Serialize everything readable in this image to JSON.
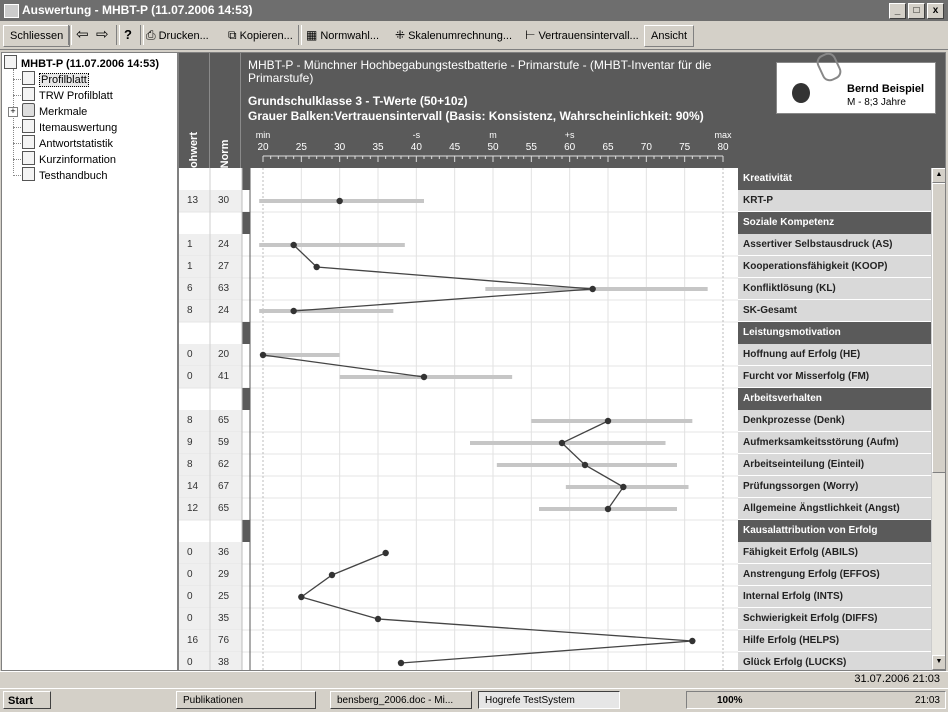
{
  "window": {
    "title": "Auswertung - MHBT-P (11.07.2006 14:53)",
    "min": "_",
    "max": "□",
    "close": "x"
  },
  "toolbar": {
    "close_label": "Schliessen",
    "back_glyph": "⇦",
    "fwd_glyph": "⇨",
    "help_glyph": "?",
    "print_label": "Drucken...",
    "copy_label": "Kopieren...",
    "norm_label": "Normwahl...",
    "scale_label": "Skalenumrechnung...",
    "conf_label": "Vertrauensintervall...",
    "view_label": "Ansicht"
  },
  "tree": {
    "root": "MHBT-P (11.07.2006 14:53)",
    "items": [
      "Profilblatt",
      "TRW Profilblatt",
      "Merkmale",
      "Itemauswertung",
      "Antwortstatistik",
      "Kurzinformation",
      "Testhandbuch"
    ]
  },
  "header": {
    "col_raw": "Rohwert",
    "col_norm": "Norm",
    "title": "MHBT-P - Münchner Hochbegabungstestbatterie - Primarstufe - (MHBT-Inventar für die Primarstufe)",
    "subtitle": "Grundschulklasse 3  -  T-Werte (50+10z)",
    "subtitle2": "Grauer Balken:Vertrauensintervall (Basis: Konsistenz, Wahrscheinlichkeit: 90%)",
    "person_name": "Bernd Beispiel",
    "person_info": "M - 8;3 Jahre"
  },
  "scale": {
    "labels_top": [
      {
        "v": 20,
        "t": "min"
      },
      {
        "v": 40,
        "t": "-s"
      },
      {
        "v": 50,
        "t": "m"
      },
      {
        "v": 60,
        "t": "+s"
      },
      {
        "v": 80,
        "t": "max"
      }
    ],
    "ticks": [
      20,
      25,
      30,
      35,
      40,
      45,
      50,
      55,
      60,
      65,
      70,
      75,
      80
    ]
  },
  "chart_data": {
    "type": "line",
    "xlim": [
      20,
      80
    ],
    "rows": [
      {
        "kind": "cat",
        "label": "Kreativität"
      },
      {
        "kind": "item",
        "label": "KRT-P",
        "raw": "13",
        "norm": "30",
        "ci": [
          19.5,
          41
        ]
      },
      {
        "kind": "cat",
        "label": "Soziale Kompetenz"
      },
      {
        "kind": "item",
        "label": "Assertiver Selbstausdruck (AS)",
        "raw": "1",
        "norm": "24",
        "ci": [
          19.5,
          38.5
        ]
      },
      {
        "kind": "item",
        "label": "Kooperationsfähigkeit (KOOP)",
        "raw": "1",
        "norm": "27",
        "ci": null
      },
      {
        "kind": "item",
        "label": "Konfliktlösung (KL)",
        "raw": "6",
        "norm": "63",
        "ci": [
          49,
          78
        ]
      },
      {
        "kind": "item",
        "label": "SK-Gesamt",
        "raw": "8",
        "norm": "24",
        "ci": [
          19.5,
          37
        ]
      },
      {
        "kind": "cat",
        "label": "Leistungsmotivation"
      },
      {
        "kind": "item",
        "label": "Hoffnung auf Erfolg (HE)",
        "raw": "0",
        "norm": "20",
        "ci": [
          20,
          30
        ]
      },
      {
        "kind": "item",
        "label": "Furcht vor Misserfolg (FM)",
        "raw": "0",
        "norm": "41",
        "ci": [
          30,
          52.5
        ]
      },
      {
        "kind": "cat",
        "label": "Arbeitsverhalten"
      },
      {
        "kind": "item",
        "label": "Denkprozesse (Denk)",
        "raw": "8",
        "norm": "65",
        "ci": [
          55,
          76
        ]
      },
      {
        "kind": "item",
        "label": "Aufmerksamkeitsstörung (Aufm)",
        "raw": "9",
        "norm": "59",
        "ci": [
          47,
          72.5
        ]
      },
      {
        "kind": "item",
        "label": "Arbeitseinteilung (Einteil)",
        "raw": "8",
        "norm": "62",
        "ci": [
          50.5,
          74
        ]
      },
      {
        "kind": "item",
        "label": "Prüfungssorgen (Worry)",
        "raw": "14",
        "norm": "67",
        "ci": [
          59.5,
          75.5
        ]
      },
      {
        "kind": "item",
        "label": "Allgemeine Ängstlichkeit (Angst)",
        "raw": "12",
        "norm": "65",
        "ci": [
          56,
          74
        ]
      },
      {
        "kind": "cat",
        "label": "Kausalattribution von Erfolg"
      },
      {
        "kind": "item",
        "label": "Fähigkeit Erfolg (ABILS)",
        "raw": "0",
        "norm": "36",
        "ci": null
      },
      {
        "kind": "item",
        "label": "Anstrengung Erfolg (EFFOS)",
        "raw": "0",
        "norm": "29",
        "ci": null
      },
      {
        "kind": "item",
        "label": "Internal Erfolg (INTS)",
        "raw": "0",
        "norm": "25",
        "ci": null
      },
      {
        "kind": "item",
        "label": "Schwierigkeit Erfolg (DIFFS)",
        "raw": "0",
        "norm": "35",
        "ci": null
      },
      {
        "kind": "item",
        "label": "Hilfe Erfolg (HELPS)",
        "raw": "16",
        "norm": "76",
        "ci": null
      },
      {
        "kind": "item",
        "label": "Glück Erfolg (LUCKS)",
        "raw": "0",
        "norm": "38",
        "ci": null
      }
    ],
    "line_groups": [
      [
        3,
        4,
        5,
        6
      ],
      [
        8,
        9
      ],
      [
        11,
        12,
        13,
        14,
        15
      ],
      [
        17,
        18,
        19,
        20,
        21,
        22
      ]
    ]
  },
  "status": {
    "datetime": "31.07.2006  21:03"
  },
  "taskbar": {
    "start": "Start",
    "tasks": [
      "Publikationen",
      "bensberg_2006.doc - Mi...",
      "Hogrefe TestSystem"
    ],
    "zoom": "100%",
    "clock": "21:03"
  }
}
